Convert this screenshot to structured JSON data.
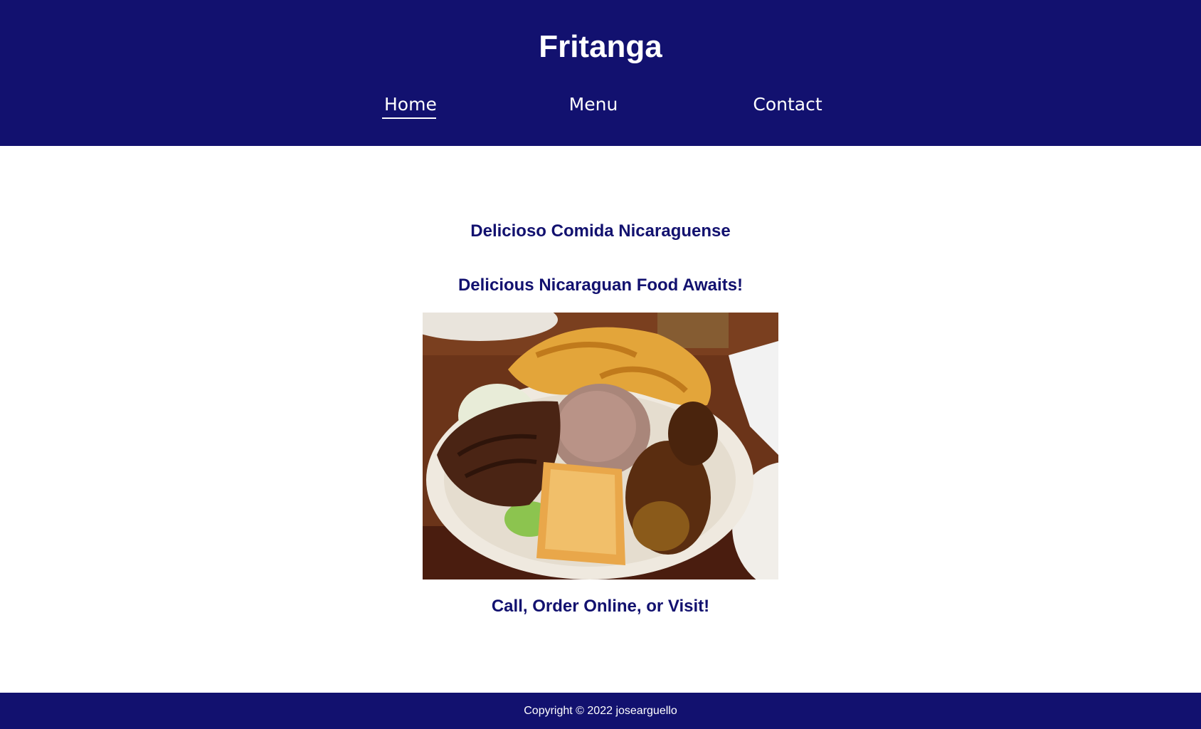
{
  "site": {
    "title": "Fritanga"
  },
  "nav": {
    "items": [
      {
        "label": "Home",
        "active": true
      },
      {
        "label": "Menu",
        "active": false
      },
      {
        "label": "Contact",
        "active": false
      }
    ]
  },
  "main": {
    "heading_spanish": "Delicioso Comida Nicaraguense",
    "heading_english": "Delicious Nicaraguan Food Awaits!",
    "image": {
      "icon": "food-plate-photo"
    },
    "call_to_action": "Call, Order Online, or Visit!"
  },
  "footer": {
    "copyright": "Copyright © 2022 josearguello"
  },
  "colors": {
    "brand_navy": "#12116f",
    "text_white": "#ffffff",
    "background": "#ffffff"
  }
}
